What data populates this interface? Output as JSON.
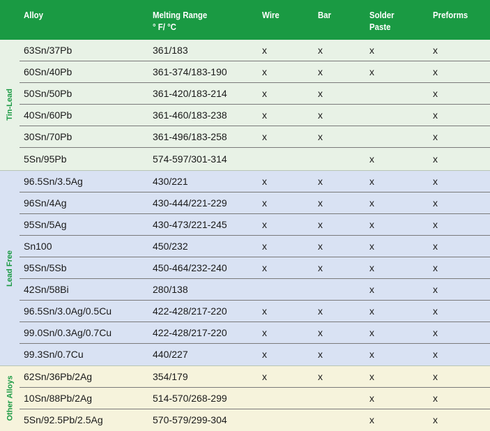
{
  "header": {
    "alloy": "Alloy",
    "melting": "Melting Range\n° F/ °C",
    "wire": "Wire",
    "bar": "Bar",
    "paste": "Solder\nPaste",
    "preforms": "Preforms"
  },
  "colors": {
    "header": "#1a9a43",
    "tin_lead_bg": "#e8f2e6",
    "lead_free_bg": "#d9e2f3",
    "other_bg": "#f6f3dc"
  },
  "sections": [
    {
      "label": "Tin-Lead",
      "rows": [
        {
          "alloy": "63Sn/37Pb",
          "melting": "361/183",
          "wire": "x",
          "bar": "x",
          "paste": "x",
          "preforms": "x"
        },
        {
          "alloy": "60Sn/40Pb",
          "melting": "361-374/183-190",
          "wire": "x",
          "bar": "x",
          "paste": "x",
          "preforms": "x"
        },
        {
          "alloy": "50Sn/50Pb",
          "melting": "361-420/183-214",
          "wire": "x",
          "bar": "x",
          "paste": "",
          "preforms": "x"
        },
        {
          "alloy": "40Sn/60Pb",
          "melting": "361-460/183-238",
          "wire": "x",
          "bar": "x",
          "paste": "",
          "preforms": "x"
        },
        {
          "alloy": "30Sn/70Pb",
          "melting": "361-496/183-258",
          "wire": "x",
          "bar": "x",
          "paste": "",
          "preforms": "x"
        },
        {
          "alloy": "5Sn/95Pb",
          "melting": "574-597/301-314",
          "wire": "",
          "bar": "",
          "paste": "x",
          "preforms": "x"
        }
      ]
    },
    {
      "label": "Lead Free",
      "rows": [
        {
          "alloy": "96.5Sn/3.5Ag",
          "melting": "430/221",
          "wire": "x",
          "bar": "x",
          "paste": "x",
          "preforms": "x"
        },
        {
          "alloy": "96Sn/4Ag",
          "melting": "430-444/221-229",
          "wire": "x",
          "bar": "x",
          "paste": "x",
          "preforms": "x"
        },
        {
          "alloy": "95Sn/5Ag",
          "melting": "430-473/221-245",
          "wire": "x",
          "bar": "x",
          "paste": "x",
          "preforms": "x"
        },
        {
          "alloy": "Sn100",
          "melting": "450/232",
          "wire": "x",
          "bar": "x",
          "paste": "x",
          "preforms": "x"
        },
        {
          "alloy": "95Sn/5Sb",
          "melting": "450-464/232-240",
          "wire": "x",
          "bar": "x",
          "paste": "x",
          "preforms": "x"
        },
        {
          "alloy": "42Sn/58Bi",
          "melting": "280/138",
          "wire": "",
          "bar": "",
          "paste": "x",
          "preforms": "x"
        },
        {
          "alloy": "96.5Sn/3.0Ag/0.5Cu",
          "melting": "422-428/217-220",
          "wire": "x",
          "bar": "x",
          "paste": "x",
          "preforms": "x"
        },
        {
          "alloy": "99.0Sn/0.3Ag/0.7Cu",
          "melting": "422-428/217-220",
          "wire": "x",
          "bar": "x",
          "paste": "x",
          "preforms": "x"
        },
        {
          "alloy": "99.3Sn/0.7Cu",
          "melting": "440/227",
          "wire": "x",
          "bar": "x",
          "paste": "x",
          "preforms": "x"
        }
      ]
    },
    {
      "label": "Other Alloys",
      "rows": [
        {
          "alloy": "62Sn/36Pb/2Ag",
          "melting": "354/179",
          "wire": "x",
          "bar": "x",
          "paste": "x",
          "preforms": "x"
        },
        {
          "alloy": "10Sn/88Pb/2Ag",
          "melting": "514-570/268-299",
          "wire": "",
          "bar": "",
          "paste": "x",
          "preforms": "x"
        },
        {
          "alloy": "5Sn/92.5Pb/2.5Ag",
          "melting": "570-579/299-304",
          "wire": "",
          "bar": "",
          "paste": "x",
          "preforms": "x"
        }
      ]
    }
  ]
}
